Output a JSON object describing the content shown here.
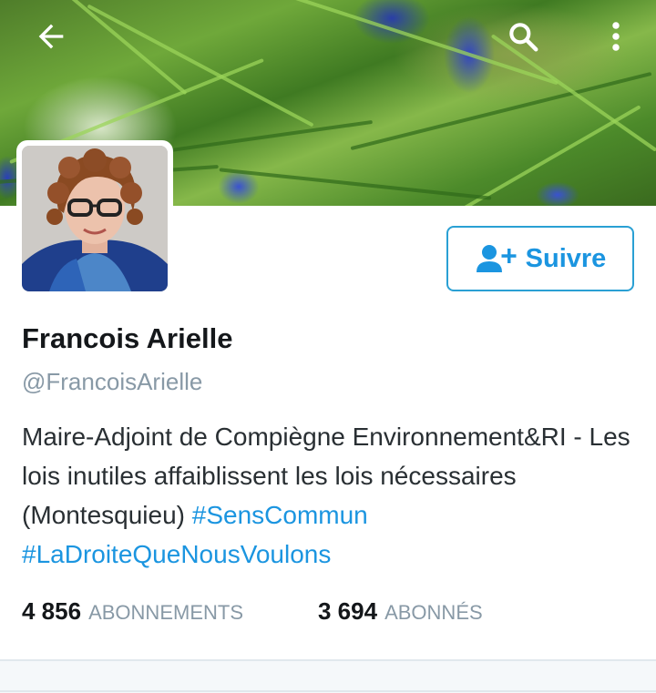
{
  "header": {
    "back_icon": "arrow-left-icon",
    "search_icon": "search-icon",
    "menu_icon": "more-vertical-icon"
  },
  "profile": {
    "name": "Francois Arielle",
    "handle": "@FrancoisArielle",
    "bio_text": "Maire-Adjoint de Compiègne Environnement&RI - Les lois inutiles affaiblissent les lois nécessaires (Montesquieu) ",
    "hashtags": [
      "#SensCommun",
      "#LaDroiteQueNousVoulons"
    ]
  },
  "follow_button": {
    "label": "Suivre",
    "icon": "add-user-icon"
  },
  "stats": {
    "following_count": "4 856",
    "following_label": "ABONNEMENTS",
    "followers_count": "3 694",
    "followers_label": "ABONNÉS"
  },
  "colors": {
    "accent": "#1b95e0",
    "text": "#14171a",
    "muted": "#8899a6"
  }
}
